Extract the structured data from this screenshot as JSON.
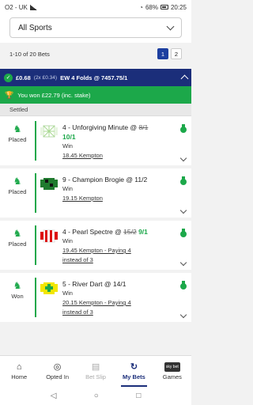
{
  "status": {
    "carrier": "O2 - UK",
    "battery": "68%",
    "time": "20:25"
  },
  "filter": {
    "sport": "All Sports"
  },
  "pagination": {
    "summary": "1-10 of 20 Bets",
    "pages": [
      "1",
      "2"
    ],
    "current": "1"
  },
  "bet": {
    "stake": "£0.68",
    "breakdown": "(2x £0.34)",
    "type": "EW 4 Folds @ 7457.75/1",
    "won_text": "You won £22.79 (inc. stake)",
    "section": "Settled"
  },
  "legs": [
    {
      "result": "Placed",
      "selection": "4 - Unforgiving Minute @ ",
      "old_price": "8/1",
      "new_price": "10/1",
      "line2": "Win",
      "race": "18.45 Kempton",
      "note": ""
    },
    {
      "result": "Placed",
      "selection": "9 - Champion Brogie @ 11/2",
      "old_price": "",
      "new_price": "",
      "line2": "Win",
      "race": "19.15 Kempton",
      "note": ""
    },
    {
      "result": "Placed",
      "selection": "4 - Pearl Spectre @ ",
      "old_price": "15/2",
      "new_price": "9/1",
      "line2": "Win",
      "race": "19.45 Kempton - Paying 4",
      "note": "instead of 3"
    },
    {
      "result": "Won",
      "selection": "5 - River Dart @ 14/1",
      "old_price": "",
      "new_price": "",
      "line2": "Win",
      "race": "20.15 Kempton - Paying 4",
      "note": "instead of 3"
    }
  ],
  "nav": {
    "home": "Home",
    "opted_in": "Opted In",
    "bet_slip": "Bet Slip",
    "my_bets": "My Bets",
    "games": "Games",
    "games_badge": "sky bet"
  },
  "colors": {
    "brand_navy": "#1b2e7a",
    "win_green": "#1ca84a"
  }
}
